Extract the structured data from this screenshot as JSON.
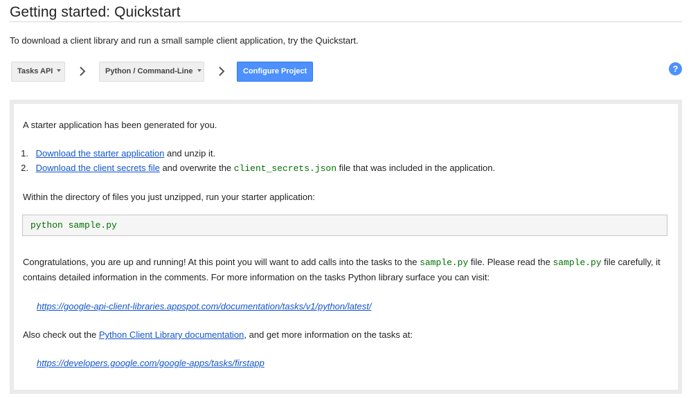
{
  "header": {
    "title": "Getting started: Quickstart"
  },
  "intro": "To download a client library and run a small sample client application, try the Quickstart.",
  "toolbar": {
    "api_select": "Tasks API",
    "platform_select": "Python / Command-Line",
    "configure_button": "Configure Project",
    "help_label": "?"
  },
  "content": {
    "starter_line": "A starter application has been generated for you.",
    "step1": {
      "num": "1.",
      "link": "Download the starter application",
      "rest": " and unzip it."
    },
    "step2": {
      "num": "2.",
      "link": "Download the client secrets file",
      "mid": " and overwrite the ",
      "code": "client_secrets.json",
      "rest": " file that was included in the application."
    },
    "run_line": "Within the directory of files you just unzipped, run your starter application:",
    "command": "python sample.py",
    "congrats": {
      "a": "Congratulations, you are up and running! At this point you will want to add calls into the tasks to the ",
      "code1": "sample.py",
      "b": " file. Please read the ",
      "code2": "sample.py",
      "c": " file carefully, it",
      "line2": "contains detailed information in the comments. For more information on the tasks Python library surface you can visit:"
    },
    "docs_url": "https://google-api-client-libraries.appspot.com/documentation/tasks/v1/python/latest/",
    "also": {
      "a": "Also check out the ",
      "link": "Python Client Library documentation",
      "b": ", and get more information on the tasks at:"
    },
    "firstapp_url": "https://developers.google.com/google-apps/tasks/firstapp"
  }
}
